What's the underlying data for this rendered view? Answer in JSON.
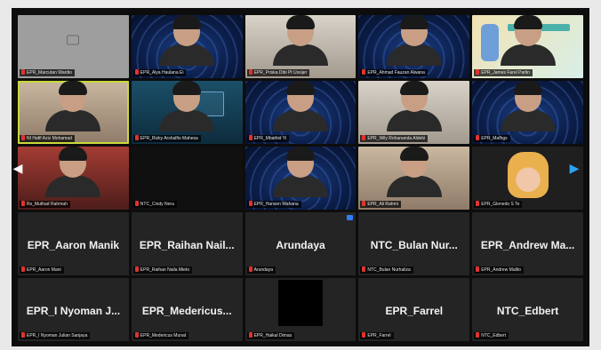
{
  "tiles": [
    {
      "name": "EPR_Marcutan Wardio",
      "bg": "bg-gray",
      "type": "camoff"
    },
    {
      "name": "EPR_Alya Haulana Ei",
      "bg": "bg-rings",
      "type": "video"
    },
    {
      "name": "EPR_Priska Dibi Pt Ussijer",
      "bg": "bg-room",
      "type": "video"
    },
    {
      "name": "EPR_Ahmad Fauzan Alwana",
      "bg": "bg-rings",
      "type": "video"
    },
    {
      "name": "EPR_James Farel Parlin",
      "bg": "bg-cartoon",
      "type": "cartoon"
    },
    {
      "name": "NI Hafif Aziz Mohamad",
      "bg": "bg-warm",
      "type": "video",
      "speaking": true
    },
    {
      "name": "EPR_Rizky Arshalfio Mahesa",
      "bg": "bg-teal",
      "type": "video"
    },
    {
      "name": "EPR_Mbathid Yi",
      "bg": "bg-rings",
      "type": "video"
    },
    {
      "name": "EPR_Wily Rohananda Aldebi",
      "bg": "bg-room",
      "type": "video"
    },
    {
      "name": "EPR_Mafhgs",
      "bg": "bg-rings",
      "type": "video"
    },
    {
      "name": "Rs_Muthad Rahmah",
      "bg": "bg-red",
      "type": "video"
    },
    {
      "name": "NTC_Cindy Nera",
      "bg": "bg-black",
      "type": "black"
    },
    {
      "name": "EPR_Hansen Wahana",
      "bg": "bg-rings",
      "type": "video"
    },
    {
      "name": "EPR_Ali Rahmi",
      "bg": "bg-warm",
      "type": "video"
    },
    {
      "name": "EPR_Glenedo S Te",
      "bg": "bg-anime",
      "type": "anime"
    },
    {
      "name": "EPR_Aaron Mani",
      "big": "EPR_Aaron Manik",
      "bg": "",
      "type": "name"
    },
    {
      "name": "EPR_Raihan Naila Mieto",
      "big": "EPR_Raihan Nail...",
      "bg": "",
      "type": "name"
    },
    {
      "name": "Arundaya",
      "big": "Arundaya",
      "bg": "",
      "type": "name",
      "camIcon": true
    },
    {
      "name": "NTC_Bulan Nurhaliza",
      "big": "NTC_Bulan Nur...",
      "bg": "",
      "type": "name"
    },
    {
      "name": "EPR_Andrew Mutlio",
      "big": "EPR_Andrew Ma...",
      "bg": "",
      "type": "name"
    },
    {
      "name": "EPR_I Nyoman Julian Sanjaya",
      "big": "EPR_I Nyoman J...",
      "bg": "",
      "type": "name"
    },
    {
      "name": "EPR_Medericus Munat",
      "big": "EPR_Medericus...",
      "bg": "",
      "type": "name"
    },
    {
      "name": "EPR_Haikal Dimas",
      "big": "",
      "bg": "",
      "type": "blackbox"
    },
    {
      "name": "EPR_Farrel",
      "big": "EPR_Farrel",
      "bg": "",
      "type": "name"
    },
    {
      "name": "NTC_Edbert",
      "big": "NTC_Edbert",
      "bg": "",
      "type": "name"
    }
  ],
  "nav": {
    "prev": "◀",
    "next": "▶"
  }
}
